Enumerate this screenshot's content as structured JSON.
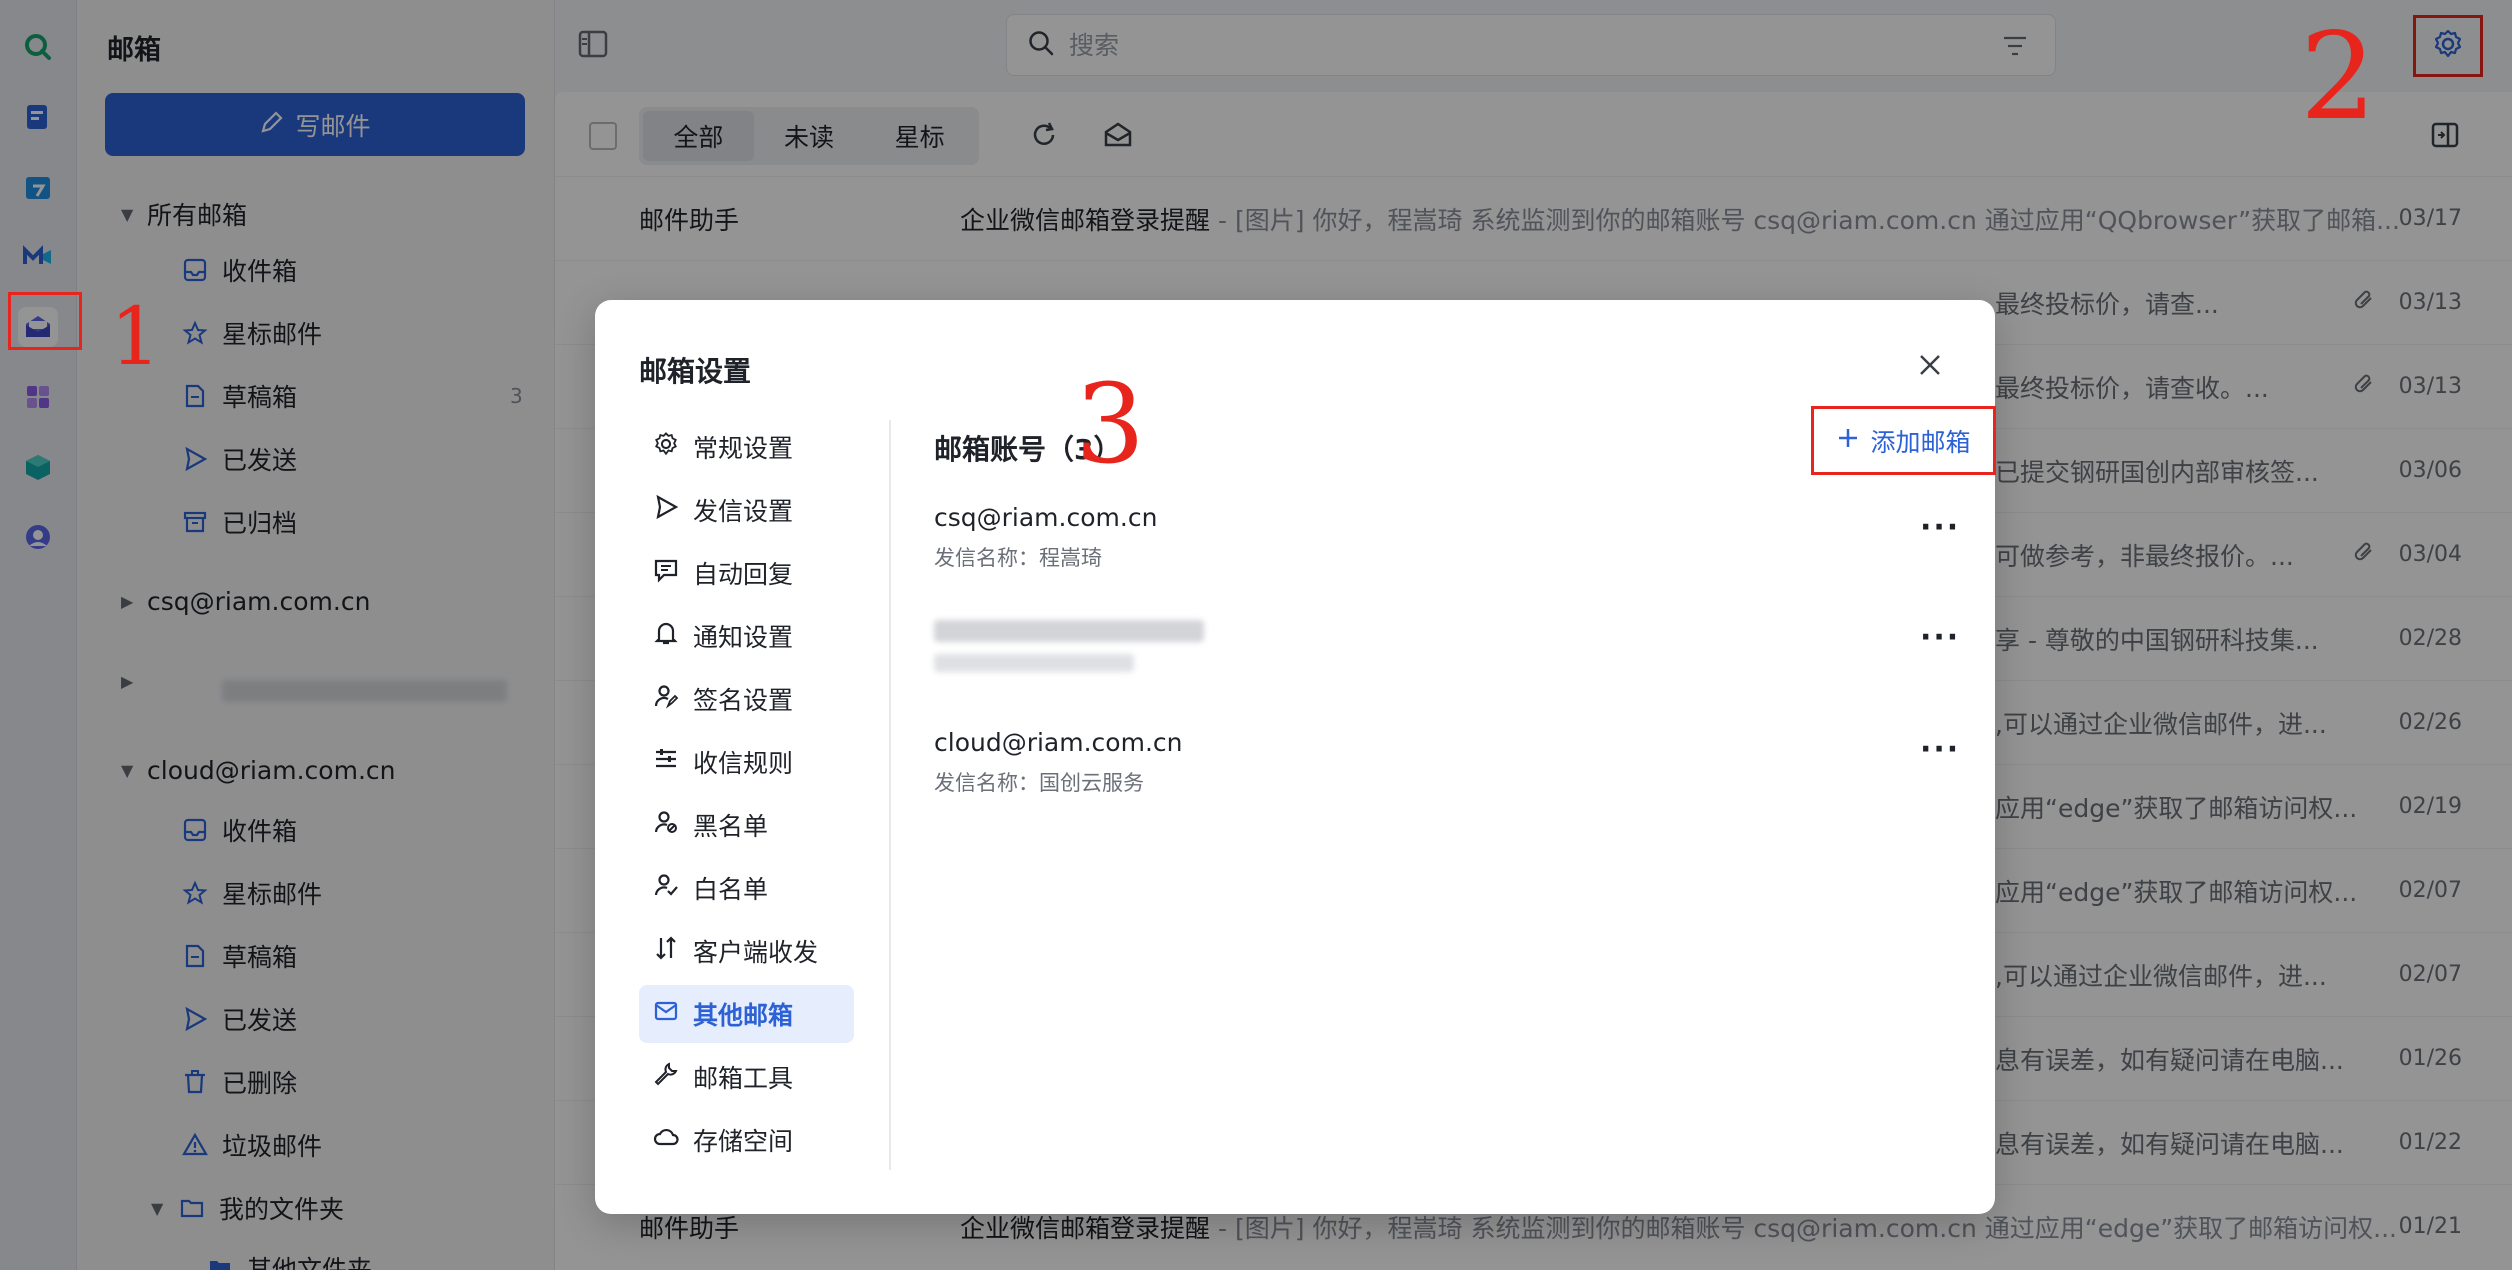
{
  "app": {
    "title": "邮箱"
  },
  "compose": {
    "label": "写邮件"
  },
  "folders": {
    "all_mail": {
      "label": "所有邮箱",
      "items": [
        {
          "label": "收件箱"
        },
        {
          "label": "星标邮件"
        },
        {
          "label": "草稿箱",
          "count": "3"
        },
        {
          "label": "已发送"
        },
        {
          "label": "已归档"
        }
      ]
    },
    "account1": "csq@riam.com.cn",
    "account3": {
      "label": "cloud@riam.com.cn",
      "items": [
        {
          "label": "收件箱"
        },
        {
          "label": "星标邮件"
        },
        {
          "label": "草稿箱"
        },
        {
          "label": "已发送"
        },
        {
          "label": "已删除"
        },
        {
          "label": "垃圾邮件"
        }
      ]
    },
    "my_folders": "我的文件夹",
    "other_folder": "其他文件夹"
  },
  "search": {
    "placeholder": "搜索"
  },
  "tabs": [
    {
      "label": "全部"
    },
    {
      "label": "未读"
    },
    {
      "label": "星标"
    }
  ],
  "mails": [
    {
      "sender": "邮件助手",
      "subject": "企业微信邮箱登录提醒",
      "preview": "[图片] 你好，程嵩琦 系统监测到你的邮箱账号 csq@riam.com.cn 通过应用“QQbrowser”获取了邮箱...",
      "date": "03/17"
    },
    {
      "tail": "最终投标价，请查...",
      "date": "03/13"
    },
    {
      "tail": "最终投标价，请查收。...",
      "date": "03/13"
    },
    {
      "tail": "已提交钢研国创内部审核签...",
      "date": "03/06"
    },
    {
      "tail": "可做参考，非最终报价。...",
      "date": "03/04"
    },
    {
      "tail": "享 - 尊敬的中国钢研科技集...",
      "date": "02/28"
    },
    {
      "tail": ",可以通过企业微信邮件，进...",
      "date": "02/26"
    },
    {
      "tail": "应用“edge”获取了邮箱访问权...",
      "date": "02/19"
    },
    {
      "tail": "应用“edge”获取了邮箱访问权...",
      "date": "02/07"
    },
    {
      "tail": ",可以通过企业微信邮件，进...",
      "date": "02/07"
    },
    {
      "tail": "息有误差，如有疑问请在电脑...",
      "date": "01/26"
    },
    {
      "tail": "息有误差，如有疑问请在电脑...",
      "date": "01/22"
    },
    {
      "sender": "邮件助手",
      "subject": "企业微信邮箱登录提醒",
      "preview": "[图片] 你好，程嵩琦 系统监测到你的邮箱账号 csq@riam.com.cn 通过应用“edge”获取了邮箱访问权...",
      "date": "01/21"
    }
  ],
  "dialog": {
    "title": "邮箱设置",
    "menu": [
      {
        "label": "常规设置",
        "icon": "gear-icon"
      },
      {
        "label": "发信设置",
        "icon": "send-icon"
      },
      {
        "label": "自动回复",
        "icon": "auto-reply-icon"
      },
      {
        "label": "通知设置",
        "icon": "bell-icon"
      },
      {
        "label": "签名设置",
        "icon": "signature-icon"
      },
      {
        "label": "收信规则",
        "icon": "rules-icon"
      },
      {
        "label": "黑名单",
        "icon": "blacklist-icon"
      },
      {
        "label": "白名单",
        "icon": "whitelist-icon"
      },
      {
        "label": "客户端收发",
        "icon": "client-sync-icon"
      },
      {
        "label": "其他邮箱",
        "icon": "mail-icon",
        "active": true
      },
      {
        "label": "邮箱工具",
        "icon": "wrench-icon"
      },
      {
        "label": "存储空间",
        "icon": "cloud-icon"
      }
    ],
    "section_title": "邮箱账号（3）",
    "add_label": "添加邮箱",
    "accounts": [
      {
        "email": "csq@riam.com.cn",
        "sender_name": "发信名称：程嵩琦"
      },
      {
        "email": "cloud@riam.com.cn",
        "sender_name": "发信名称：国创云服务"
      }
    ]
  },
  "annotations": {
    "a1": "1",
    "a2": "2",
    "a3": "3"
  },
  "colors": {
    "accent": "#2c62d6",
    "annotation_red": "#e8251c"
  }
}
